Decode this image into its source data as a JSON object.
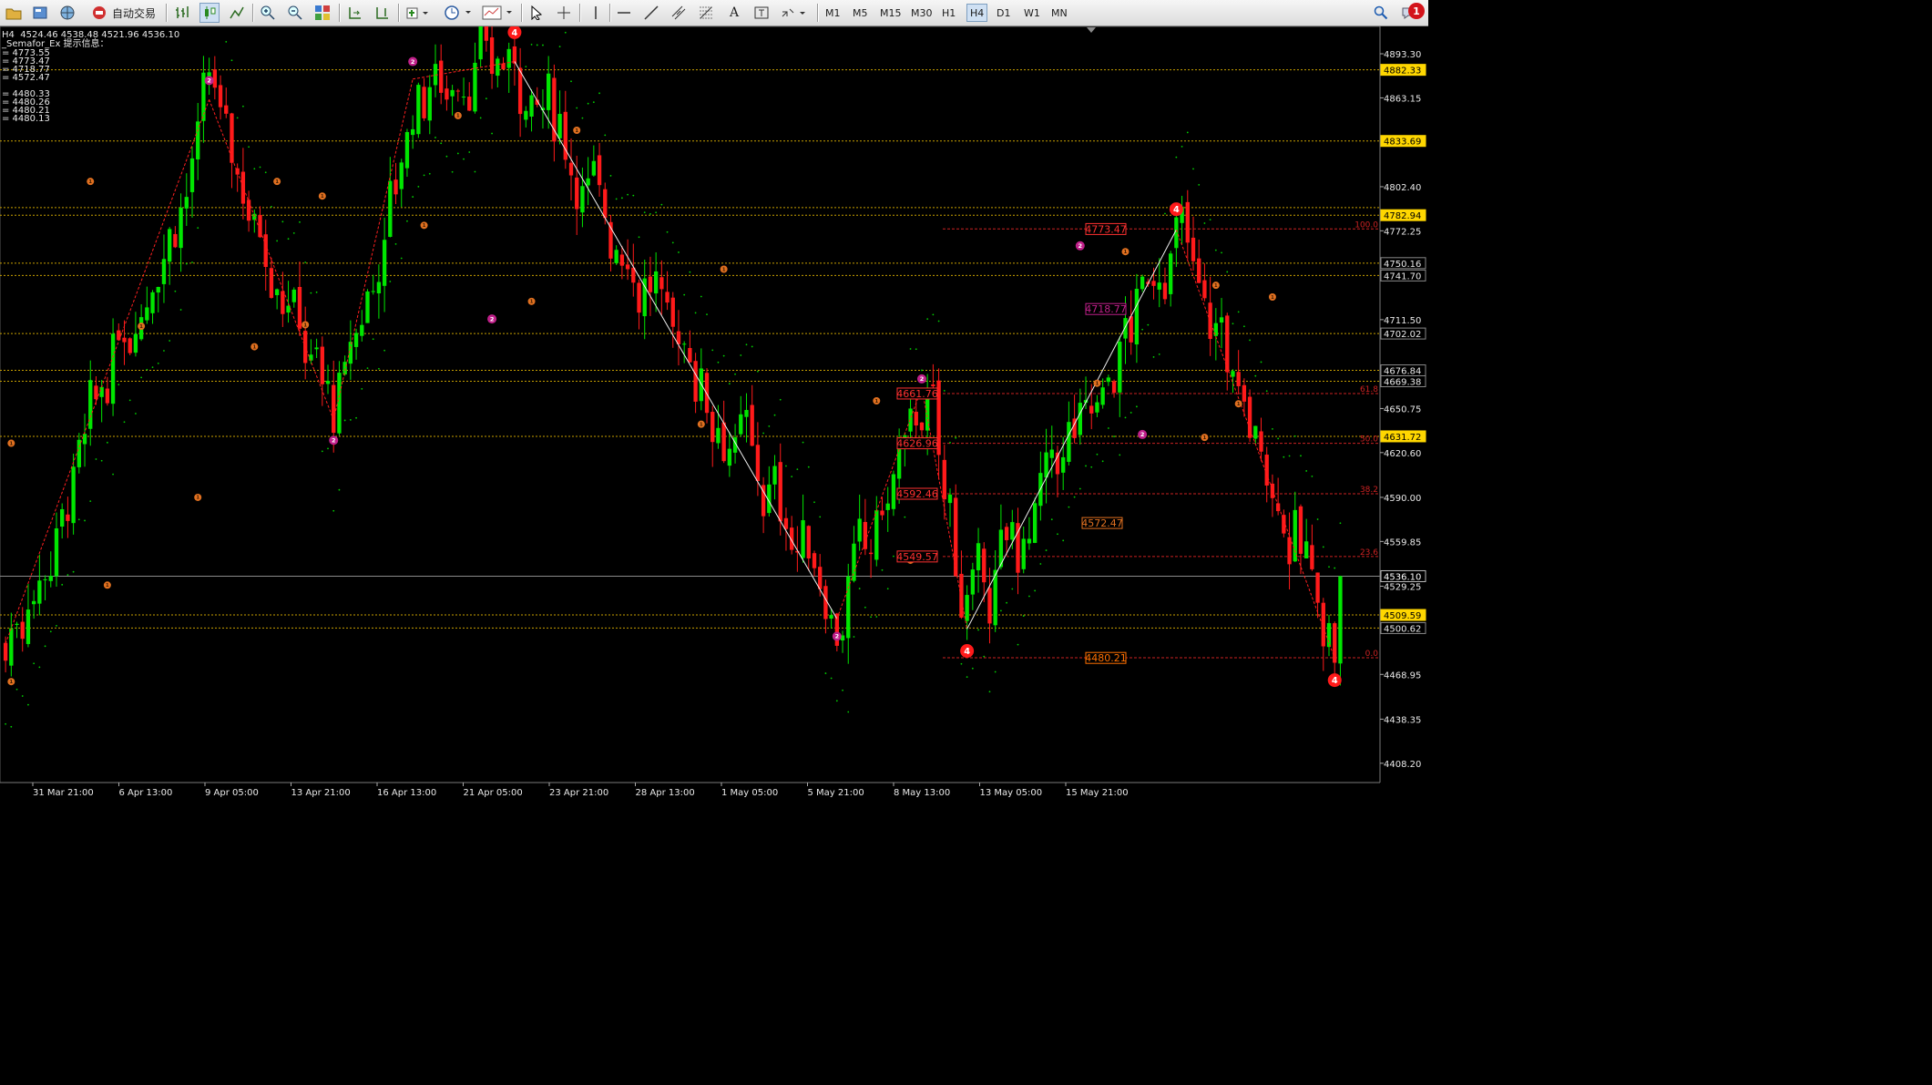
{
  "toolbar": {
    "auto_trading_label": "自动交易",
    "timeframes": [
      "M1",
      "M5",
      "M15",
      "M30",
      "H1",
      "H4",
      "D1",
      "W1",
      "MN"
    ],
    "active_timeframe": "H4",
    "alert_count": "1"
  },
  "chart_info": {
    "ohlc_line": "H4  4524.46 4538.48 4521.96 4536.10",
    "indicator_title": "_Semafor_Ex 提示信息：",
    "indicator_values": [
      "= 4773.55",
      "= 4773.47",
      "= 4718.77",
      "= 4572.47",
      "",
      "= 4480.33",
      "= 4480.26",
      "= 4480.21",
      "= 4480.13"
    ]
  },
  "colors": {
    "bull": "#00e600",
    "bear": "#ff1a1a",
    "grid": "#1a1a1a",
    "level_line": "#c8a000",
    "fib": "#cc2222",
    "semafor_1": "#e07020",
    "semafor_2": "#c0208a",
    "semafor_3": "#ff1a1a",
    "psar": "#00d000",
    "price_badge": "#ffd700"
  },
  "chart_data": {
    "type": "candlestick",
    "symbol_timeframe": "H4",
    "price_axis": {
      "range": [
        4395,
        4912
      ],
      "ticks": [
        "4893.30",
        "4863.15",
        "4802.40",
        "4772.25",
        "4711.50",
        "4650.75",
        "4620.60",
        "4590.00",
        "4559.85",
        "4529.25",
        "4468.95",
        "4438.35",
        "4408.20"
      ]
    },
    "time_axis": {
      "labels": [
        "31 Mar 21:00",
        "6 Apr 13:00",
        "9 Apr 05:00",
        "13 Apr 21:00",
        "16 Apr 13:00",
        "21 Apr 05:00",
        "23 Apr 21:00",
        "28 Apr 13:00",
        "1 May 05:00",
        "5 May 21:00",
        "8 May 13:00",
        "13 May 05:00",
        "15 May 21:00"
      ]
    },
    "current_price": 4536.1,
    "horizontal_levels": [
      {
        "price": 4882.33,
        "label": "4882.33",
        "highlight": true
      },
      {
        "price": 4833.69,
        "label": "4833.69",
        "highlight": true
      },
      {
        "price": 4788.1,
        "label": "",
        "highlight": false
      },
      {
        "price": 4782.94,
        "label": "4782.94",
        "highlight": true
      },
      {
        "price": 4750.16,
        "label": "4750.16",
        "highlight": false
      },
      {
        "price": 4741.7,
        "label": "4741.70",
        "highlight": false
      },
      {
        "price": 4702.02,
        "label": "4702.02",
        "highlight": false
      },
      {
        "price": 4676.84,
        "label": "4676.84",
        "highlight": false
      },
      {
        "price": 4669.38,
        "label": "4669.38",
        "highlight": false
      },
      {
        "price": 4631.72,
        "label": "4631.72",
        "highlight": true
      },
      {
        "price": 4509.59,
        "label": "4509.59",
        "highlight": true
      },
      {
        "price": 4500.62,
        "label": "4500.62",
        "highlight": false
      }
    ],
    "fibonacci": [
      {
        "level": "100.0",
        "price": 4773.55
      },
      {
        "level": "61.8",
        "price": 4661.0
      },
      {
        "level": "50.0",
        "price": 4626.96
      },
      {
        "level": "38.2",
        "price": 4592.46
      },
      {
        "level": "23.6",
        "price": 4549.57
      },
      {
        "level": "0.0",
        "price": 4480.33
      }
    ],
    "price_boxes": [
      {
        "text": "4773.47",
        "price": 4773.47,
        "color": "#ff3030"
      },
      {
        "text": "4718.77",
        "price": 4718.77,
        "color": "#c0208a"
      },
      {
        "text": "4661.76",
        "price": 4661.0,
        "color": "#ff3030"
      },
      {
        "text": "4626.96",
        "price": 4626.96,
        "color": "#ff3030"
      },
      {
        "text": "4592.46",
        "price": 4592.46,
        "color": "#ff3030"
      },
      {
        "text": "4572.47",
        "price": 4572.47,
        "color": "#e07020"
      },
      {
        "text": "4549.57",
        "price": 4549.57,
        "color": "#ff3030"
      },
      {
        "text": "4480.21",
        "price": 4480.21,
        "color": "#ff7000"
      }
    ],
    "zigzag": [
      {
        "bar": 0,
        "price": 4490
      },
      {
        "bar": 36,
        "price": 4862
      },
      {
        "bar": 58,
        "price": 4643
      },
      {
        "bar": 72,
        "price": 4876
      },
      {
        "bar": 90,
        "price": 4888
      },
      {
        "bar": 147,
        "price": 4507
      },
      {
        "bar": 162,
        "price": 4665
      },
      {
        "bar": 170,
        "price": 4500
      },
      {
        "bar": 207,
        "price": 4773
      },
      {
        "bar": 235,
        "price": 4480
      }
    ],
    "semafor_points": [
      {
        "bar": 36,
        "price": 4875,
        "level": 2
      },
      {
        "bar": 58,
        "price": 4629,
        "level": 2
      },
      {
        "bar": 72,
        "price": 4888,
        "level": 2
      },
      {
        "bar": 90,
        "price": 4908,
        "level": 4
      },
      {
        "bar": 86,
        "price": 4712,
        "level": 2
      },
      {
        "bar": 147,
        "price": 4495,
        "level": 2
      },
      {
        "bar": 162,
        "price": 4671,
        "level": 2
      },
      {
        "bar": 170,
        "price": 4485,
        "level": 4
      },
      {
        "bar": 190,
        "price": 4762,
        "level": 2
      },
      {
        "bar": 207,
        "price": 4787,
        "level": 4
      },
      {
        "bar": 201,
        "price": 4633,
        "level": 2
      },
      {
        "bar": 235,
        "price": 4465,
        "level": 4
      },
      {
        "bar": 15,
        "price": 4806,
        "level": 1
      },
      {
        "bar": 1,
        "price": 4627,
        "level": 1
      },
      {
        "bar": 1,
        "price": 4464,
        "level": 1
      },
      {
        "bar": 18,
        "price": 4530,
        "level": 1
      },
      {
        "bar": 24,
        "price": 4707,
        "level": 1
      },
      {
        "bar": 34,
        "price": 4590,
        "level": 1
      },
      {
        "bar": 44,
        "price": 4693,
        "level": 1
      },
      {
        "bar": 48,
        "price": 4806,
        "level": 1
      },
      {
        "bar": 53,
        "price": 4708,
        "level": 1
      },
      {
        "bar": 56,
        "price": 4796,
        "level": 1
      },
      {
        "bar": 74,
        "price": 4776,
        "level": 1
      },
      {
        "bar": 80,
        "price": 4851,
        "level": 1
      },
      {
        "bar": 93,
        "price": 4724,
        "level": 1
      },
      {
        "bar": 101,
        "price": 4841,
        "level": 1
      },
      {
        "bar": 127,
        "price": 4746,
        "level": 1
      },
      {
        "bar": 123,
        "price": 4640,
        "level": 1
      },
      {
        "bar": 154,
        "price": 4656,
        "level": 1
      },
      {
        "bar": 160,
        "price": 4547,
        "level": 1
      },
      {
        "bar": 193,
        "price": 4668,
        "level": 1
      },
      {
        "bar": 198,
        "price": 4758,
        "level": 1
      },
      {
        "bar": 212,
        "price": 4631,
        "level": 1
      },
      {
        "bar": 214,
        "price": 4735,
        "level": 1
      },
      {
        "bar": 218,
        "price": 4654,
        "level": 1
      },
      {
        "bar": 224,
        "price": 4727,
        "level": 1
      }
    ],
    "seed": 7
  }
}
